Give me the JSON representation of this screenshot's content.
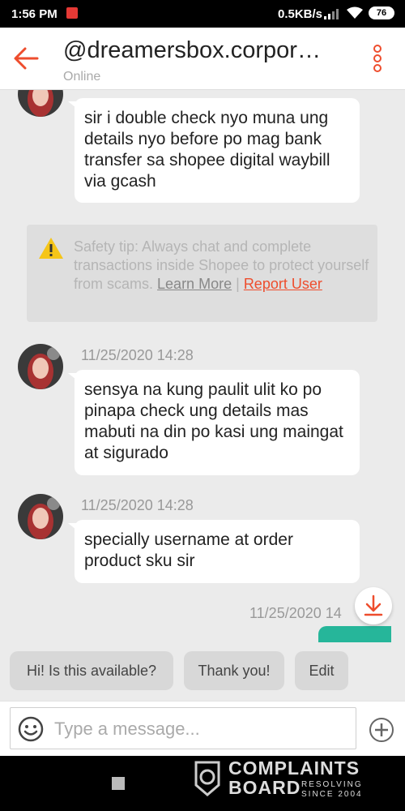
{
  "status_bar": {
    "time": "1:56 PM",
    "speed": "0.5KB/s",
    "battery": "76"
  },
  "header": {
    "title": "@dreamersbox.corpor…",
    "subtitle": "Online"
  },
  "messages": [
    {
      "sender": "them",
      "timestamp": "",
      "text": "sir i double check nyo muna ung details nyo before po mag bank transfer sa shopee digital waybill via gcash"
    },
    {
      "sender": "them",
      "timestamp": "11/25/2020 14:28",
      "text": "sensya na kung paulit ulit ko po pinapa check ung details mas mabuti na din po kasi ung maingat at sigurado"
    },
    {
      "sender": "them",
      "timestamp": "11/25/2020 14:28",
      "text": "specially username at order product sku sir"
    },
    {
      "sender": "me",
      "timestamp": "11/25/2020 14",
      "text": ""
    }
  ],
  "safety_tip": {
    "text": "Safety tip: Always chat and complete transactions inside Shopee to protect yourself from scams.",
    "learn_more": "Learn More",
    "separator": "|",
    "report_user": "Report User"
  },
  "quick_replies": [
    "Hi! Is this available?",
    "Thank you!",
    "Edit"
  ],
  "composer": {
    "placeholder": "Type a message..."
  },
  "watermark": {
    "line1": "COMPLAINTS",
    "line2": "BOARD",
    "side1": "RESOLVING",
    "side2": "SINCE 2004"
  },
  "colors": {
    "accent": "#ee4d2d",
    "sent_bubble": "#26b69a"
  },
  "icons": [
    "back-arrow-icon",
    "more-vert-icon",
    "warning-icon",
    "download-icon",
    "emoji-icon",
    "plus-icon"
  ]
}
